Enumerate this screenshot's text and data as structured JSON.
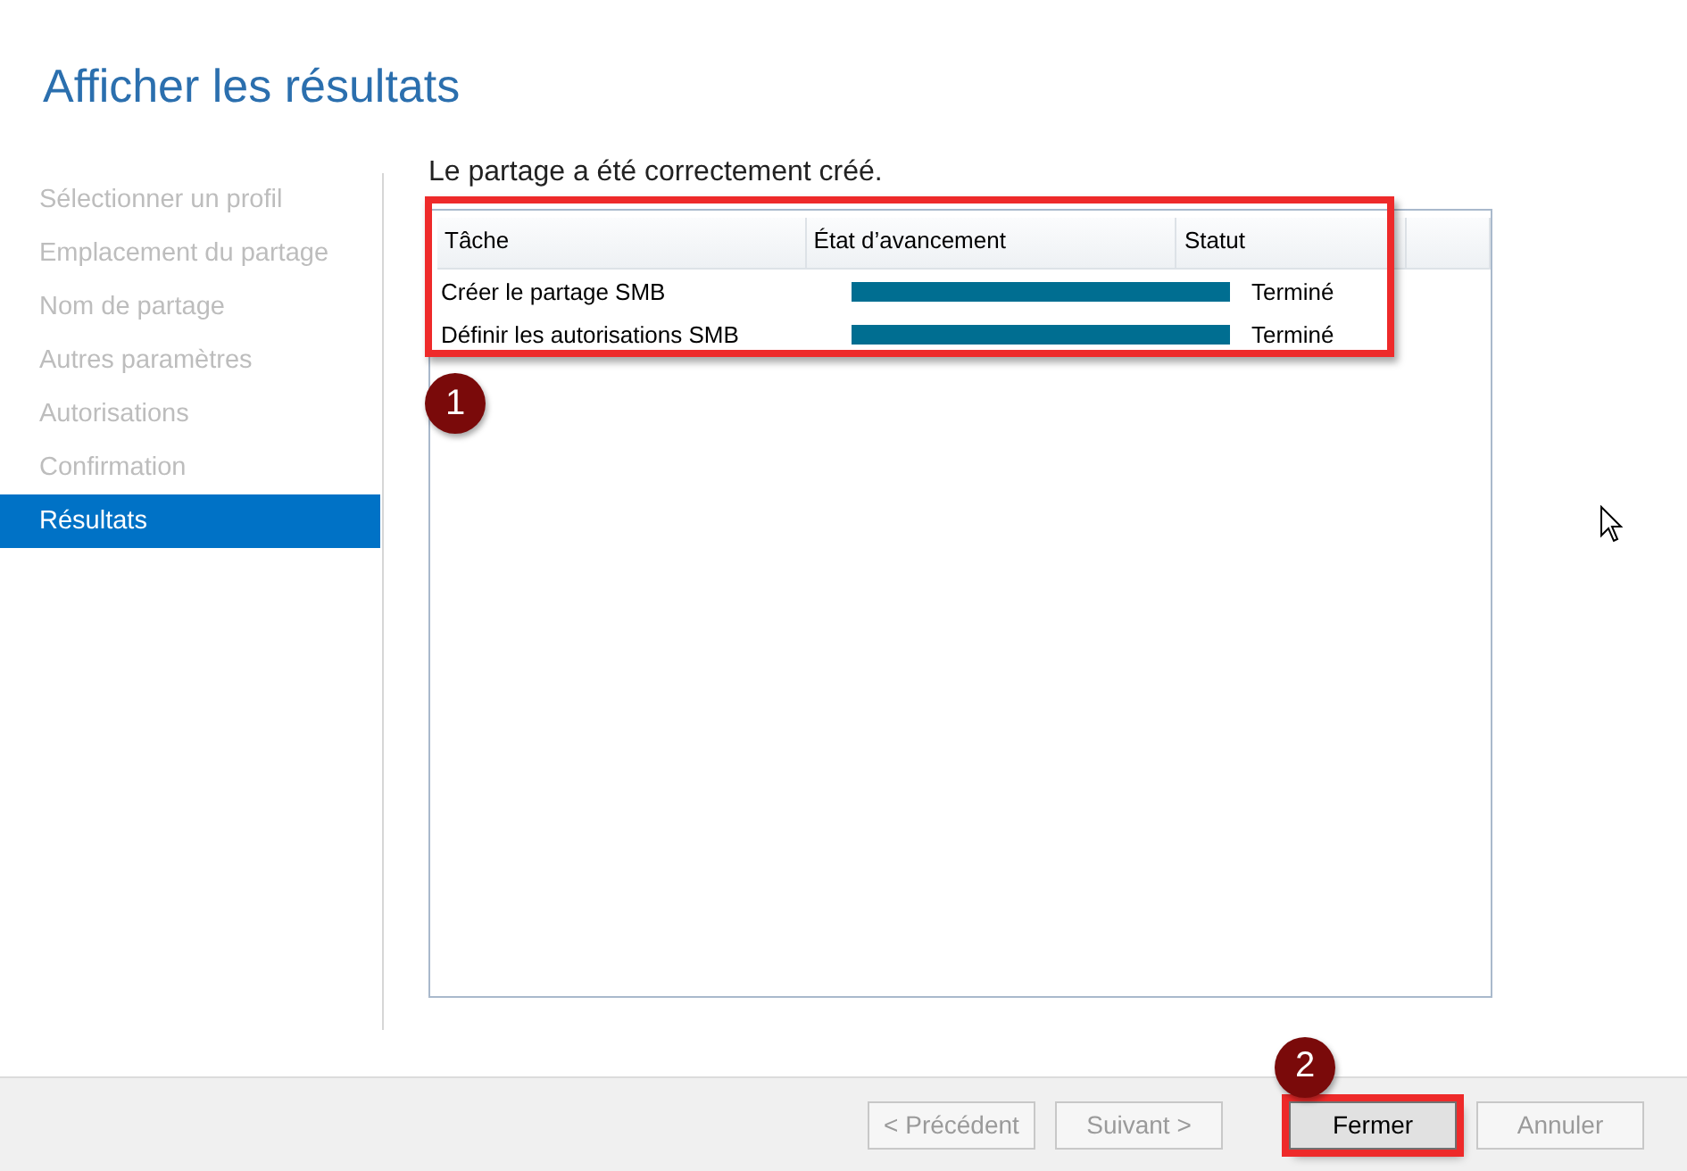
{
  "window": {
    "title": "Afficher les résultats"
  },
  "steps": [
    {
      "label": "Sélectionner un profil",
      "selected": false
    },
    {
      "label": "Emplacement du partage",
      "selected": false
    },
    {
      "label": "Nom de partage",
      "selected": false
    },
    {
      "label": "Autres paramètres",
      "selected": false
    },
    {
      "label": "Autorisations",
      "selected": false
    },
    {
      "label": "Confirmation",
      "selected": false
    },
    {
      "label": "Résultats",
      "selected": true
    }
  ],
  "message": "Le partage a été correctement créé.",
  "table": {
    "highlighted": true,
    "callout": "1",
    "columns": [
      "Tâche",
      "État d’avancement",
      "Statut"
    ],
    "rows": [
      {
        "task": "Créer le partage SMB",
        "level": 1,
        "status": "Terminé"
      },
      {
        "task": "Définir les autorisations SMB",
        "level": 1,
        "status": "Terminé"
      }
    ]
  },
  "buttons": [
    {
      "label": "< Précédent",
      "disabled": true,
      "highlighted": false
    },
    {
      "label": "Suivant >",
      "disabled": true,
      "highlighted": false
    },
    {
      "label": "Fermer",
      "disabled": false,
      "highlighted": true,
      "callout": "2"
    },
    {
      "label": "Annuler",
      "disabled": true,
      "highlighted": false
    }
  ]
}
